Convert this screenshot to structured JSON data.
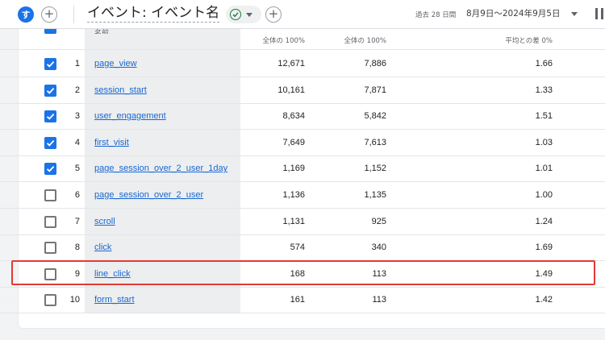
{
  "header": {
    "avatar_letter": "す",
    "title": "イベント: イベント名",
    "date_label": "過去 28 日間",
    "date_range": "8月9日～2024年9月5日"
  },
  "colors": {
    "accent": "#1a73e8",
    "link": "#1967d2",
    "highlight_border": "#e53935",
    "ok_green": "#188038"
  },
  "icons": {
    "avatar": "avatar-circle",
    "add": "plus-circle-icon",
    "status": "check-circle-icon",
    "dropdown": "chevron-down-icon",
    "chart": "bar-chart-icon",
    "checkbox": "checkbox-icon"
  },
  "table": {
    "header_name": "名前",
    "header_sub": [
      "全体の 100%",
      "全体の 100%",
      "平均との差 0%"
    ],
    "rows": [
      {
        "checked": true,
        "index": "1",
        "event": "page_view",
        "v1": "12,671",
        "v2": "7,886",
        "v3": "1.66"
      },
      {
        "checked": true,
        "index": "2",
        "event": "session_start",
        "v1": "10,161",
        "v2": "7,871",
        "v3": "1.33"
      },
      {
        "checked": true,
        "index": "3",
        "event": "user_engagement",
        "v1": "8,634",
        "v2": "5,842",
        "v3": "1.51"
      },
      {
        "checked": true,
        "index": "4",
        "event": "first_visit",
        "v1": "7,649",
        "v2": "7,613",
        "v3": "1.03"
      },
      {
        "checked": true,
        "index": "5",
        "event": "page_session_over_2_user_1day",
        "v1": "1,169",
        "v2": "1,152",
        "v3": "1.01"
      },
      {
        "checked": false,
        "index": "6",
        "event": "page_session_over_2_user",
        "v1": "1,136",
        "v2": "1,135",
        "v3": "1.00"
      },
      {
        "checked": false,
        "index": "7",
        "event": "scroll",
        "v1": "1,131",
        "v2": "925",
        "v3": "1.24"
      },
      {
        "checked": false,
        "index": "8",
        "event": "click",
        "v1": "574",
        "v2": "340",
        "v3": "1.69"
      },
      {
        "checked": false,
        "index": "9",
        "event": "line_click",
        "v1": "168",
        "v2": "113",
        "v3": "1.49"
      },
      {
        "checked": false,
        "index": "10",
        "event": "form_start",
        "v1": "161",
        "v2": "113",
        "v3": "1.42"
      }
    ]
  }
}
